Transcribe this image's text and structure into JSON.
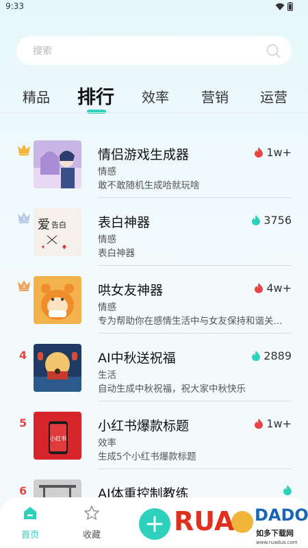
{
  "status_bar": {
    "time": "9:33"
  },
  "search": {
    "placeholder": "搜索"
  },
  "tabs": [
    {
      "label": "精品"
    },
    {
      "label": "排行"
    },
    {
      "label": "效率"
    },
    {
      "label": "营销"
    },
    {
      "label": "运营"
    }
  ],
  "active_tab": "排行",
  "ranking": [
    {
      "rank": "1",
      "title": "情侣游戏生成器",
      "category": "情感",
      "description": "敢不敢随机生成哈就玩啥",
      "stat": "1w+",
      "stat_icon": "flame-icon",
      "stat_color": "#e84545"
    },
    {
      "rank": "2",
      "title": "表白神器",
      "category": "情感",
      "description": "表白神器",
      "stat": "3756",
      "stat_icon": "flame-icon",
      "stat_color": "#2ed1bc"
    },
    {
      "rank": "3",
      "title": "哄女友神器",
      "category": "情感",
      "description": "专为帮助你在感情生活中与女友保持和谐关...",
      "stat": "4w+",
      "stat_icon": "flame-icon",
      "stat_color": "#e84545"
    },
    {
      "rank": "4",
      "title": "AI中秋送祝福",
      "category": "生活",
      "description": "自动生成中秋祝福，祝大家中秋快乐",
      "stat": "2889",
      "stat_icon": "flame-icon",
      "stat_color": "#2ed1bc"
    },
    {
      "rank": "5",
      "title": "小红书爆款标题",
      "category": "效率",
      "description": "生成5个小红书爆款标题",
      "stat": "1w+",
      "stat_icon": "flame-icon",
      "stat_color": "#e84545"
    },
    {
      "rank": "6",
      "title": "AI体重控制教练",
      "category": "",
      "description": "",
      "stat": "",
      "stat_icon": "flame-icon",
      "stat_color": "#2ed1bc"
    }
  ],
  "bottom_nav": {
    "home_label": "首页",
    "favorites_label": "收藏"
  },
  "watermark": {
    "brand": "RUAODADO",
    "cn": "如多下载网",
    "url": "www.ruaduo.com"
  },
  "colors": {
    "accent": "#2ed1bc",
    "hot": "#e84545",
    "gold": "#f2b43a",
    "silver": "#b9c7e6",
    "bronze": "#f0a25a"
  }
}
